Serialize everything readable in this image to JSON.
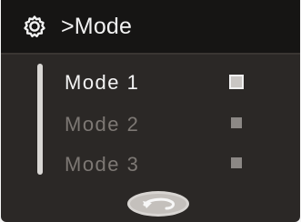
{
  "header": {
    "title": ">Mode",
    "icon": "gear-icon"
  },
  "menu": {
    "items": [
      {
        "label": "Mode 1",
        "selected": true
      },
      {
        "label": "Mode 2",
        "selected": false
      },
      {
        "label": "Mode 3",
        "selected": false
      }
    ]
  },
  "footer": {
    "back_icon": "return-arrow-icon"
  },
  "colors": {
    "background": "#2b2826",
    "header": "#161514",
    "text_selected": "#f4f4f4",
    "text_dim": "#7d7874"
  }
}
